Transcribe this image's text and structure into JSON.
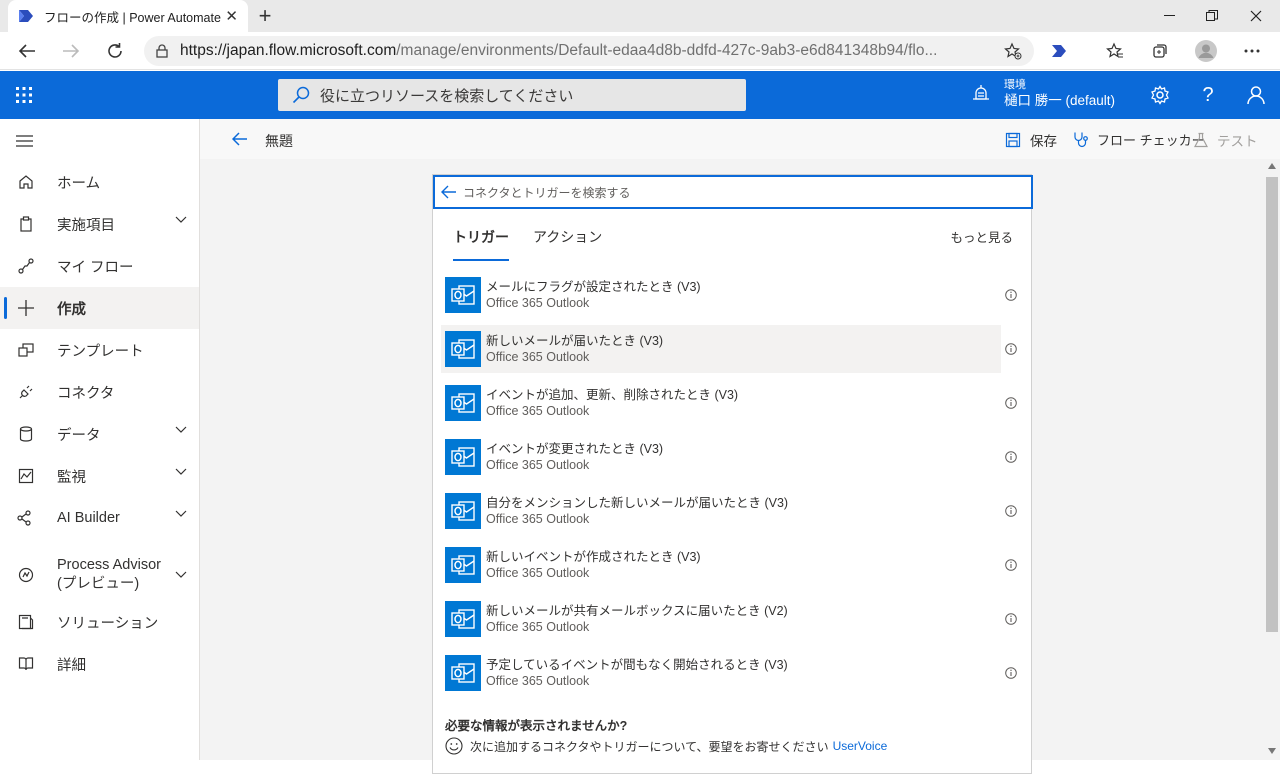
{
  "browser": {
    "tab_title": "フローの作成 | Power Automate",
    "url_host": "https://japan.flow.microsoft.com",
    "url_path": "/manage/environments/Default-edaa4d8b-ddfd-427c-9ab3-e6d841348b94/flo..."
  },
  "header": {
    "search_placeholder": "役に立つリソースを検索してください",
    "env_label": "環境",
    "env_name": "樋口 勝一 (default)"
  },
  "nav": {
    "items": [
      {
        "label": "ホーム"
      },
      {
        "label": "実施項目"
      },
      {
        "label": "マイ フロー"
      },
      {
        "label": "作成"
      },
      {
        "label": "テンプレート"
      },
      {
        "label": "コネクタ"
      },
      {
        "label": "データ"
      },
      {
        "label": "監視"
      },
      {
        "label": "AI Builder"
      },
      {
        "label": "Process Advisor (プレビュー)",
        "line1": "Process Advisor",
        "line2": "(プレビュー)"
      },
      {
        "label": "ソリューション"
      },
      {
        "label": "詳細"
      }
    ]
  },
  "command": {
    "title": "無題",
    "save": "保存",
    "checker": "フロー チェッカー",
    "test": "テスト"
  },
  "picker": {
    "search_placeholder": "コネクタとトリガーを検索する",
    "tab_triggers": "トリガー",
    "tab_actions": "アクション",
    "see_more": "もっと見る",
    "triggers": [
      {
        "title": "メールにフラグが設定されたとき (V3)",
        "connector": "Office 365 Outlook"
      },
      {
        "title": "新しいメールが届いたとき (V3)",
        "connector": "Office 365 Outlook"
      },
      {
        "title": "イベントが追加、更新、削除されたとき (V3)",
        "connector": "Office 365 Outlook"
      },
      {
        "title": "イベントが変更されたとき (V3)",
        "connector": "Office 365 Outlook"
      },
      {
        "title": "自分をメンションした新しいメールが届いたとき (V3)",
        "connector": "Office 365 Outlook"
      },
      {
        "title": "新しいイベントが作成されたとき (V3)",
        "connector": "Office 365 Outlook"
      },
      {
        "title": "新しいメールが共有メールボックスに届いたとき (V2)",
        "connector": "Office 365 Outlook"
      },
      {
        "title": "予定しているイベントが間もなく開始されるとき (V3)",
        "connector": "Office 365 Outlook"
      }
    ],
    "footer_question": "必要な情報が表示されませんか?",
    "footer_text": "次に追加するコネクタやトリガーについて、要望をお寄せください",
    "footer_link": "UserVoice"
  },
  "colors": {
    "accent": "#0b6ad9",
    "connector": "#0078d4"
  }
}
